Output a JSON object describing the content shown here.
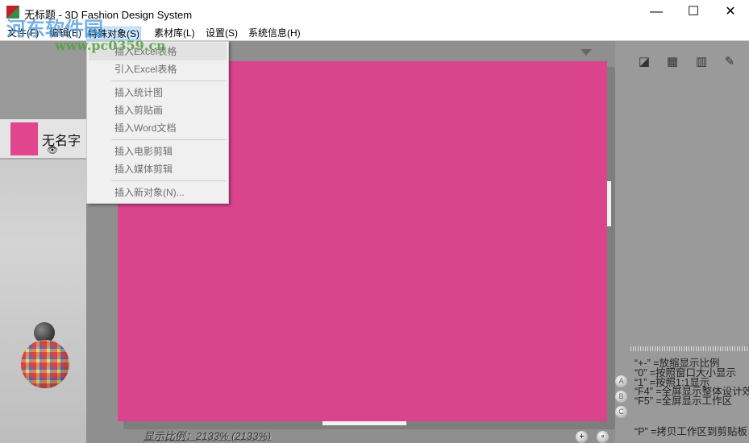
{
  "window": {
    "title": "无标题 - 3D Fashion Design System",
    "minimize": "—",
    "maximize": "☐",
    "close": "✕"
  },
  "menubar": [
    {
      "label": "文件(F)"
    },
    {
      "label": "编辑(E)"
    },
    {
      "label": "特殊对象(S)"
    },
    {
      "label": "素材库(L)"
    },
    {
      "label": "设置(S)"
    },
    {
      "label": "系统信息(H)"
    }
  ],
  "dropdown": {
    "items": [
      {
        "label": "插入Excel表格",
        "highlighted": true
      },
      {
        "label": "引入Excel表格"
      },
      {
        "label": "插入统计图"
      },
      {
        "label": "插入剪贴画"
      },
      {
        "label": "插入Word文档"
      },
      {
        "label": "插入电影剪辑"
      },
      {
        "label": "插入媒体剪辑"
      },
      {
        "label": "插入新对象(N)..."
      }
    ]
  },
  "layers": [
    {
      "name": "无名字",
      "color": "#e0458e",
      "visible_icon": "eye-icon"
    }
  ],
  "canvas": {
    "color": "#d9448c"
  },
  "status": {
    "zoom_label": "显示比例：2133% (2133%)"
  },
  "help": [
    "“+-” =放缩显示比例",
    "“0” =按照窗口大小显示",
    "“1” =按照1:1显示",
    "“F4” =全屏显示整体设计效",
    "“F5” =全屏显示工作区",
    "“P” =拷贝工作区到剪贴板"
  ],
  "view_buttons": [
    "A",
    "B",
    "C"
  ],
  "watermark": {
    "name": "河东软件园",
    "url": "www.pc0359.cn"
  }
}
